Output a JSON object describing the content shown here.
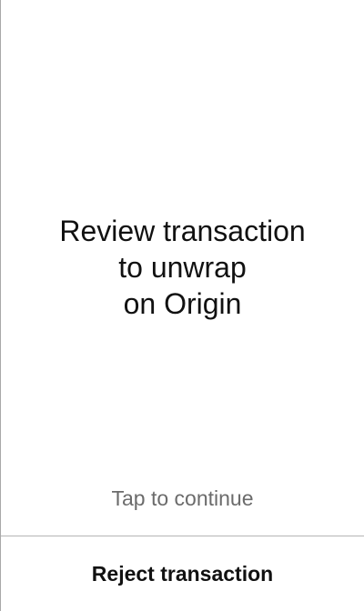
{
  "review": {
    "title_lines": [
      "Review transaction",
      "to unwrap",
      "on Origin"
    ],
    "hint": "Tap to continue"
  },
  "footer": {
    "reject_label": "Reject transaction"
  }
}
